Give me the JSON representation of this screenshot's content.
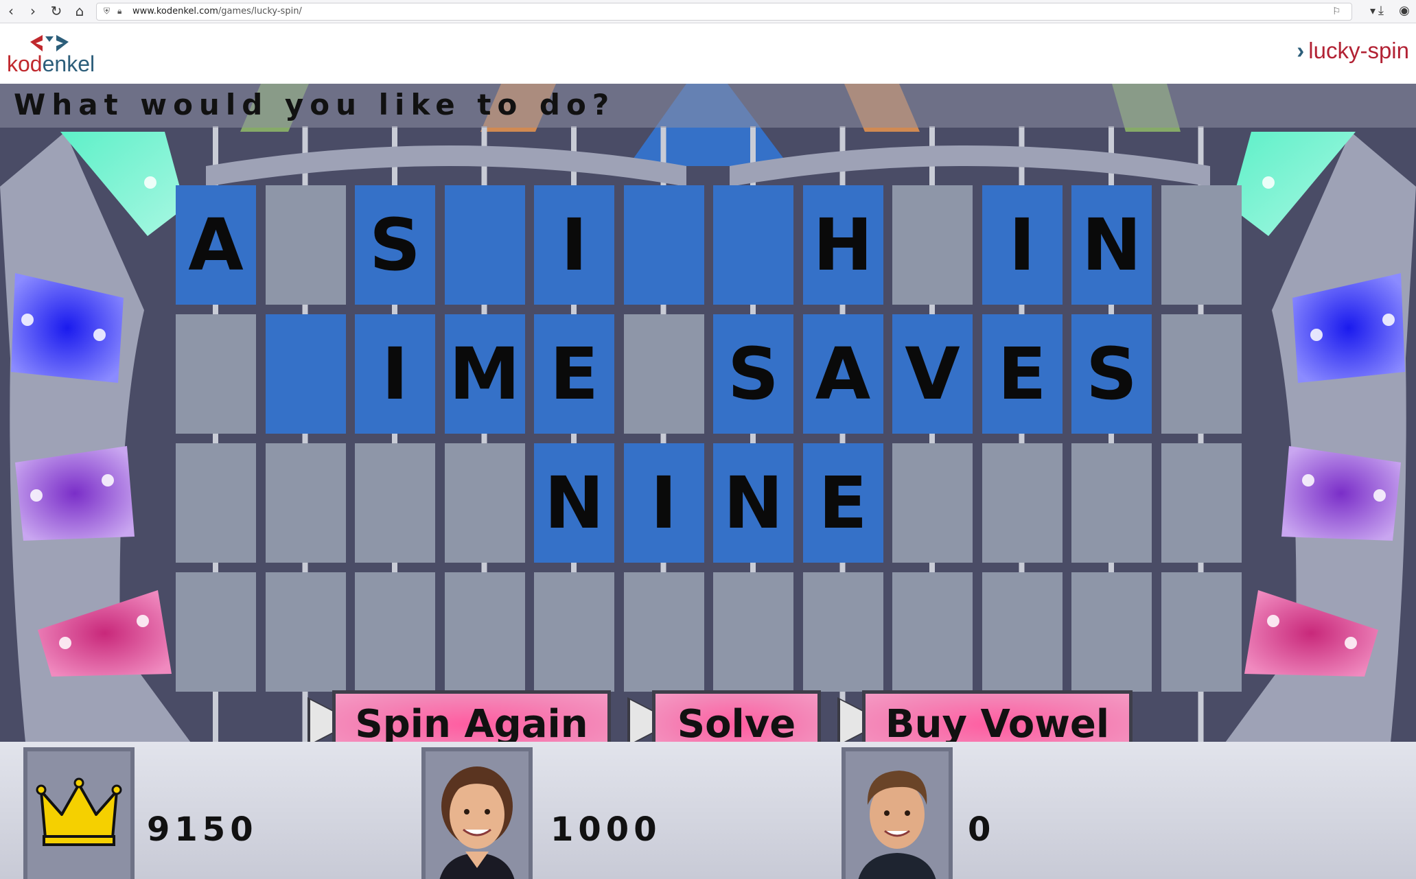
{
  "browser": {
    "url_domain": "www.kodenkel.com",
    "url_path": "/games/lucky-spin/"
  },
  "site": {
    "logo_kod": "kod",
    "logo_enkel": "enkel",
    "breadcrumb_arrow": "›",
    "breadcrumb": "lucky-spin"
  },
  "game": {
    "prompt": "What would you like to do?",
    "board_rows": [
      [
        {
          "letter": "A",
          "lit": true
        },
        {
          "letter": "",
          "lit": false
        },
        {
          "letter": "S",
          "lit": true
        },
        {
          "letter": "",
          "lit": true
        },
        {
          "letter": "I",
          "lit": true
        },
        {
          "letter": "",
          "lit": true
        },
        {
          "letter": "",
          "lit": true
        },
        {
          "letter": "H",
          "lit": true
        },
        {
          "letter": "",
          "lit": false
        },
        {
          "letter": "I",
          "lit": true
        },
        {
          "letter": "N",
          "lit": true
        },
        {
          "letter": "",
          "lit": false
        }
      ],
      [
        {
          "letter": "",
          "lit": false
        },
        {
          "letter": "",
          "lit": true
        },
        {
          "letter": "I",
          "lit": true
        },
        {
          "letter": "M",
          "lit": true
        },
        {
          "letter": "E",
          "lit": true
        },
        {
          "letter": "",
          "lit": false
        },
        {
          "letter": "S",
          "lit": true
        },
        {
          "letter": "A",
          "lit": true
        },
        {
          "letter": "V",
          "lit": true
        },
        {
          "letter": "E",
          "lit": true
        },
        {
          "letter": "S",
          "lit": true
        },
        {
          "letter": "",
          "lit": false
        }
      ],
      [
        {
          "letter": "",
          "lit": false
        },
        {
          "letter": "",
          "lit": false
        },
        {
          "letter": "",
          "lit": false
        },
        {
          "letter": "",
          "lit": false
        },
        {
          "letter": "N",
          "lit": true
        },
        {
          "letter": "I",
          "lit": true
        },
        {
          "letter": "N",
          "lit": true
        },
        {
          "letter": "E",
          "lit": true
        },
        {
          "letter": "",
          "lit": false
        },
        {
          "letter": "",
          "lit": false
        },
        {
          "letter": "",
          "lit": false
        },
        {
          "letter": "",
          "lit": false
        }
      ],
      [
        {
          "letter": "",
          "lit": false
        },
        {
          "letter": "",
          "lit": false
        },
        {
          "letter": "",
          "lit": false
        },
        {
          "letter": "",
          "lit": false
        },
        {
          "letter": "",
          "lit": false
        },
        {
          "letter": "",
          "lit": false
        },
        {
          "letter": "",
          "lit": false
        },
        {
          "letter": "",
          "lit": false
        },
        {
          "letter": "",
          "lit": false
        },
        {
          "letter": "",
          "lit": false
        },
        {
          "letter": "",
          "lit": false
        },
        {
          "letter": "",
          "lit": false
        }
      ]
    ],
    "actions": {
      "spin_again": "Spin Again",
      "solve": "Solve",
      "buy_vowel": "Buy Vowel"
    },
    "players": [
      {
        "portrait": "crown-icon",
        "score": "9150"
      },
      {
        "portrait": "woman-portrait",
        "score": "1000"
      },
      {
        "portrait": "man-portrait",
        "score": "0"
      }
    ]
  },
  "colors": {
    "tile_lit": "#3571c8",
    "tile_blank": "#8e96a8",
    "button_pink": "#f484b6",
    "brand_red": "#b22234",
    "brand_blue": "#2c5e7a"
  }
}
